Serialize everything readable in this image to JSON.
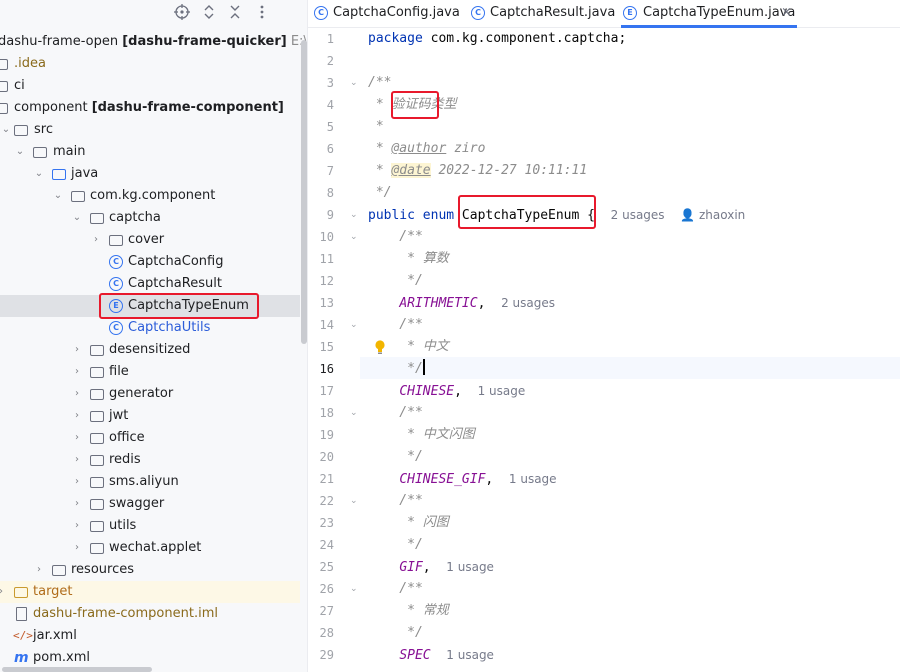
{
  "project_tree": {
    "toolbar": {
      "locate_icon": "crosshair-icon",
      "expand_icon": "expand-collapse-icon",
      "collapse_icon": "collapse-all-icon",
      "options_icon": "more-icon"
    },
    "root": {
      "name": "dashu-frame-open",
      "module": "[dashu-frame-quicker]",
      "path": "E:\\Ide"
    },
    "nodes": [
      {
        "label": ".idea"
      },
      {
        "label": "ci"
      },
      {
        "label": "component",
        "module": "[dashu-frame-component]"
      },
      {
        "label": "src"
      },
      {
        "label": "main"
      },
      {
        "label": "java"
      },
      {
        "label": "com.kg.component"
      },
      {
        "label": "captcha"
      },
      {
        "label": "cover"
      },
      {
        "label": "CaptchaConfig",
        "icon": "C"
      },
      {
        "label": "CaptchaResult",
        "icon": "C"
      },
      {
        "label": "CaptchaTypeEnum",
        "icon": "E"
      },
      {
        "label": "CaptchaUtils",
        "icon": "C"
      },
      {
        "label": "desensitized"
      },
      {
        "label": "file"
      },
      {
        "label": "generator"
      },
      {
        "label": "jwt"
      },
      {
        "label": "office"
      },
      {
        "label": "redis"
      },
      {
        "label": "sms.aliyun"
      },
      {
        "label": "swagger"
      },
      {
        "label": "utils"
      },
      {
        "label": "wechat.applet"
      },
      {
        "label": "resources"
      },
      {
        "label": "target"
      },
      {
        "label": "dashu-frame-component.iml"
      },
      {
        "label": "jar.xml"
      },
      {
        "label": "pom.xml"
      }
    ]
  },
  "tabs": [
    {
      "label": "CaptchaConfig.java",
      "icon": "C"
    },
    {
      "label": "CaptchaResult.java",
      "icon": "C"
    },
    {
      "label": "CaptchaTypeEnum.java",
      "icon": "E",
      "close": "×"
    }
  ],
  "editor": {
    "current_line": 16,
    "line_numbers": [
      "1",
      "2",
      "3",
      "4",
      "5",
      "6",
      "7",
      "8",
      "9",
      "10",
      "11",
      "12",
      "13",
      "14",
      "15",
      "16",
      "17",
      "18",
      "19",
      "20",
      "21",
      "22",
      "23",
      "24",
      "25",
      "26",
      "27",
      "28",
      "29"
    ],
    "code": {
      "l1_kw": "package",
      "l1_rest": " com.kg.component.captcha;",
      "l3": "/**",
      "l4_star": " * ",
      "l4_text": "验证码类型",
      "l5": " *",
      "l6_star": " * ",
      "l6_tag": "@author",
      "l6_val": " ziro",
      "l7_star": " * ",
      "l7_tag": "@date",
      "l7_val": " 2022-12-27 10:11:11",
      "l8": " */",
      "l9_kw": "public enum ",
      "l9_name": "CaptchaTypeEnum",
      "l9_brace": " {",
      "l9_usages": "2 usages",
      "l9_author": "zhaoxin",
      "l10": "    /**",
      "l11": "     * 算数",
      "l12": "     */",
      "l13_const": "ARITHMETIC",
      "l13_comma": ",",
      "l13_usages": "2 usages",
      "l14": "    /**",
      "l15": "     * 中文",
      "l16": "     */",
      "l17_const": "CHINESE",
      "l17_comma": ",",
      "l17_usages": "1 usage",
      "l18": "    /**",
      "l19": "     * 中文闪图",
      "l20": "     */",
      "l21_const": "CHINESE_GIF",
      "l21_comma": ",",
      "l21_usages": "1 usage",
      "l22": "    /**",
      "l23": "     * 闪图",
      "l24": "     */",
      "l25_const": "GIF",
      "l25_comma": ",",
      "l25_usages": "1 usage",
      "l26": "    /**",
      "l27": "     * 常规",
      "l28": "     */",
      "l29_const": "SPEC",
      "l29_usages": "1 usage"
    }
  },
  "colors": {
    "keyword": "#0033b3",
    "comment": "#8c8c8c",
    "enum_constant": "#871094",
    "highlight_box": "#e8192c",
    "active_tab": "#3574f0"
  }
}
